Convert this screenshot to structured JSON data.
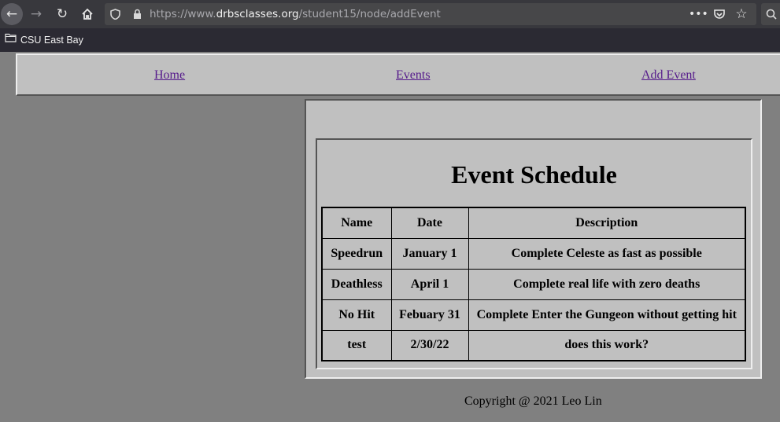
{
  "browser": {
    "url_prefix": "https://www.",
    "url_domain": "drbsclasses.org",
    "url_path": "/student15/node/addEvent",
    "icons": {
      "back": "back-arrow-icon",
      "forward": "forward-arrow-icon",
      "reload": "reload-icon",
      "home": "home-icon",
      "tracking": "shield-icon",
      "lock": "lock-icon",
      "menu": "more-icon",
      "pocket": "pocket-icon",
      "bookmark": "star-icon",
      "search": "search-icon"
    }
  },
  "bookmarks": [
    {
      "label": "CSU East Bay"
    }
  ],
  "nav": {
    "home": "Home",
    "events": "Events",
    "add_event": "Add Event"
  },
  "schedule": {
    "title": "Event Schedule",
    "headers": [
      "Name",
      "Date",
      "Description"
    ],
    "rows": [
      [
        "Speedrun",
        "January 1",
        "Complete Celeste as fast as possible"
      ],
      [
        "Deathless",
        "April 1",
        "Complete real life with zero deaths"
      ],
      [
        "No Hit",
        "Febuary 31",
        "Complete Enter the Gungeon without getting hit"
      ],
      [
        "test",
        "2/30/22",
        "does this work?"
      ]
    ]
  },
  "footer": "Copyright @ 2021 Leo Lin",
  "colors": {
    "page_bg": "#808080",
    "panel_bg": "#c0c0c0",
    "link": "#551a8b",
    "toolbar": "#38383d"
  }
}
